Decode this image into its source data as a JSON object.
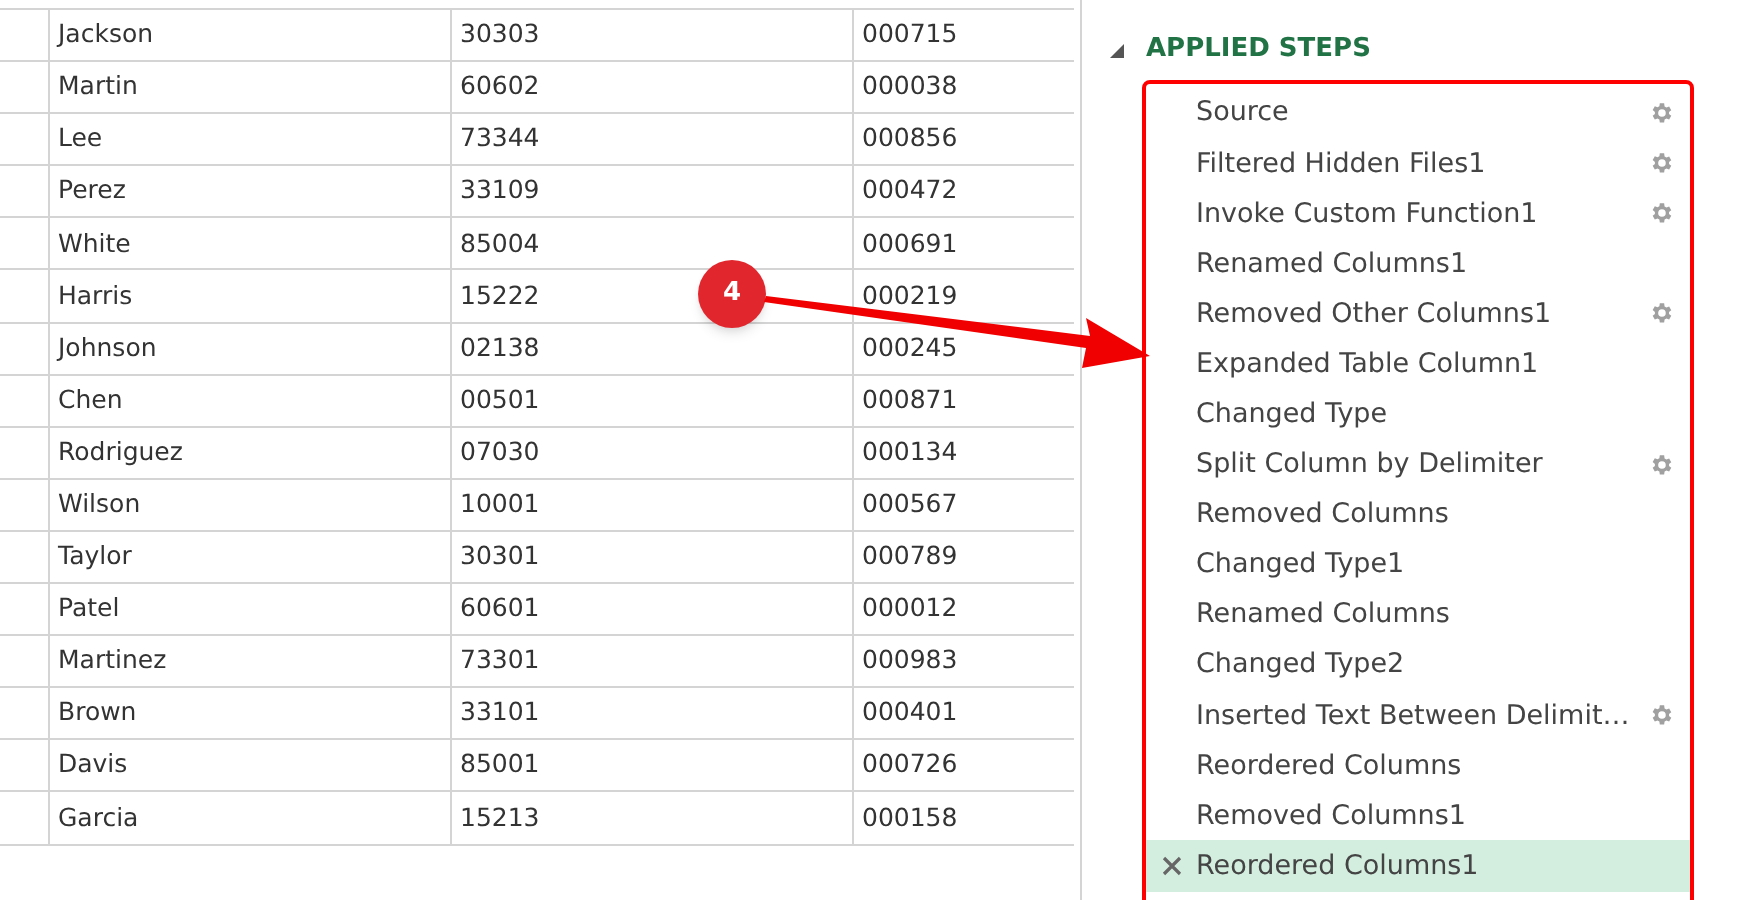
{
  "table": {
    "rows": [
      {
        "column_1": "Jackson",
        "column_2": "30303",
        "column_3": "000715"
      },
      {
        "column_1": "Martin",
        "column_2": "60602",
        "column_3": "000038"
      },
      {
        "column_1": "Lee",
        "column_2": "73344",
        "column_3": "000856"
      },
      {
        "column_1": "Perez",
        "column_2": "33109",
        "column_3": "000472"
      },
      {
        "column_1": "White",
        "column_2": "85004",
        "column_3": "000691"
      },
      {
        "column_1": "Harris",
        "column_2": "15222",
        "column_3": "000219"
      },
      {
        "column_1": "Johnson",
        "column_2": "02138",
        "column_3": "000245"
      },
      {
        "column_1": "Chen",
        "column_2": "00501",
        "column_3": "000871"
      },
      {
        "column_1": "Rodriguez",
        "column_2": "07030",
        "column_3": "000134"
      },
      {
        "column_1": "Wilson",
        "column_2": "10001",
        "column_3": "000567"
      },
      {
        "column_1": "Taylor",
        "column_2": "30301",
        "column_3": "000789"
      },
      {
        "column_1": "Patel",
        "column_2": "60601",
        "column_3": "000012"
      },
      {
        "column_1": "Martinez",
        "column_2": "73301",
        "column_3": "000983"
      },
      {
        "column_1": "Brown",
        "column_2": "33101",
        "column_3": "000401"
      },
      {
        "column_1": "Davis",
        "column_2": "85001",
        "column_3": "000726"
      },
      {
        "column_1": "Garcia",
        "column_2": "15213",
        "column_3": "000158"
      }
    ]
  },
  "applied_steps": {
    "title": "APPLIED STEPS",
    "expanded": true,
    "steps": [
      {
        "label": "Source",
        "has_settings": true,
        "selected": false
      },
      {
        "label": "Filtered Hidden Files1",
        "has_settings": true,
        "selected": false
      },
      {
        "label": "Invoke Custom Function1",
        "has_settings": true,
        "selected": false
      },
      {
        "label": "Renamed Columns1",
        "has_settings": false,
        "selected": false
      },
      {
        "label": "Removed Other Columns1",
        "has_settings": true,
        "selected": false
      },
      {
        "label": "Expanded Table Column1",
        "has_settings": false,
        "selected": false
      },
      {
        "label": "Changed Type",
        "has_settings": false,
        "selected": false
      },
      {
        "label": "Split Column by Delimiter",
        "has_settings": true,
        "selected": false
      },
      {
        "label": "Removed Columns",
        "has_settings": false,
        "selected": false
      },
      {
        "label": "Changed Type1",
        "has_settings": false,
        "selected": false
      },
      {
        "label": "Renamed Columns",
        "has_settings": false,
        "selected": false
      },
      {
        "label": "Changed Type2",
        "has_settings": false,
        "selected": false
      },
      {
        "label": "Inserted Text Between Delimit…",
        "has_settings": true,
        "selected": false
      },
      {
        "label": "Reordered Columns",
        "has_settings": false,
        "selected": false
      },
      {
        "label": "Removed Columns1",
        "has_settings": false,
        "selected": false
      },
      {
        "label": "Reordered Columns1",
        "has_settings": false,
        "selected": true
      }
    ]
  },
  "callout": {
    "number": "4"
  }
}
